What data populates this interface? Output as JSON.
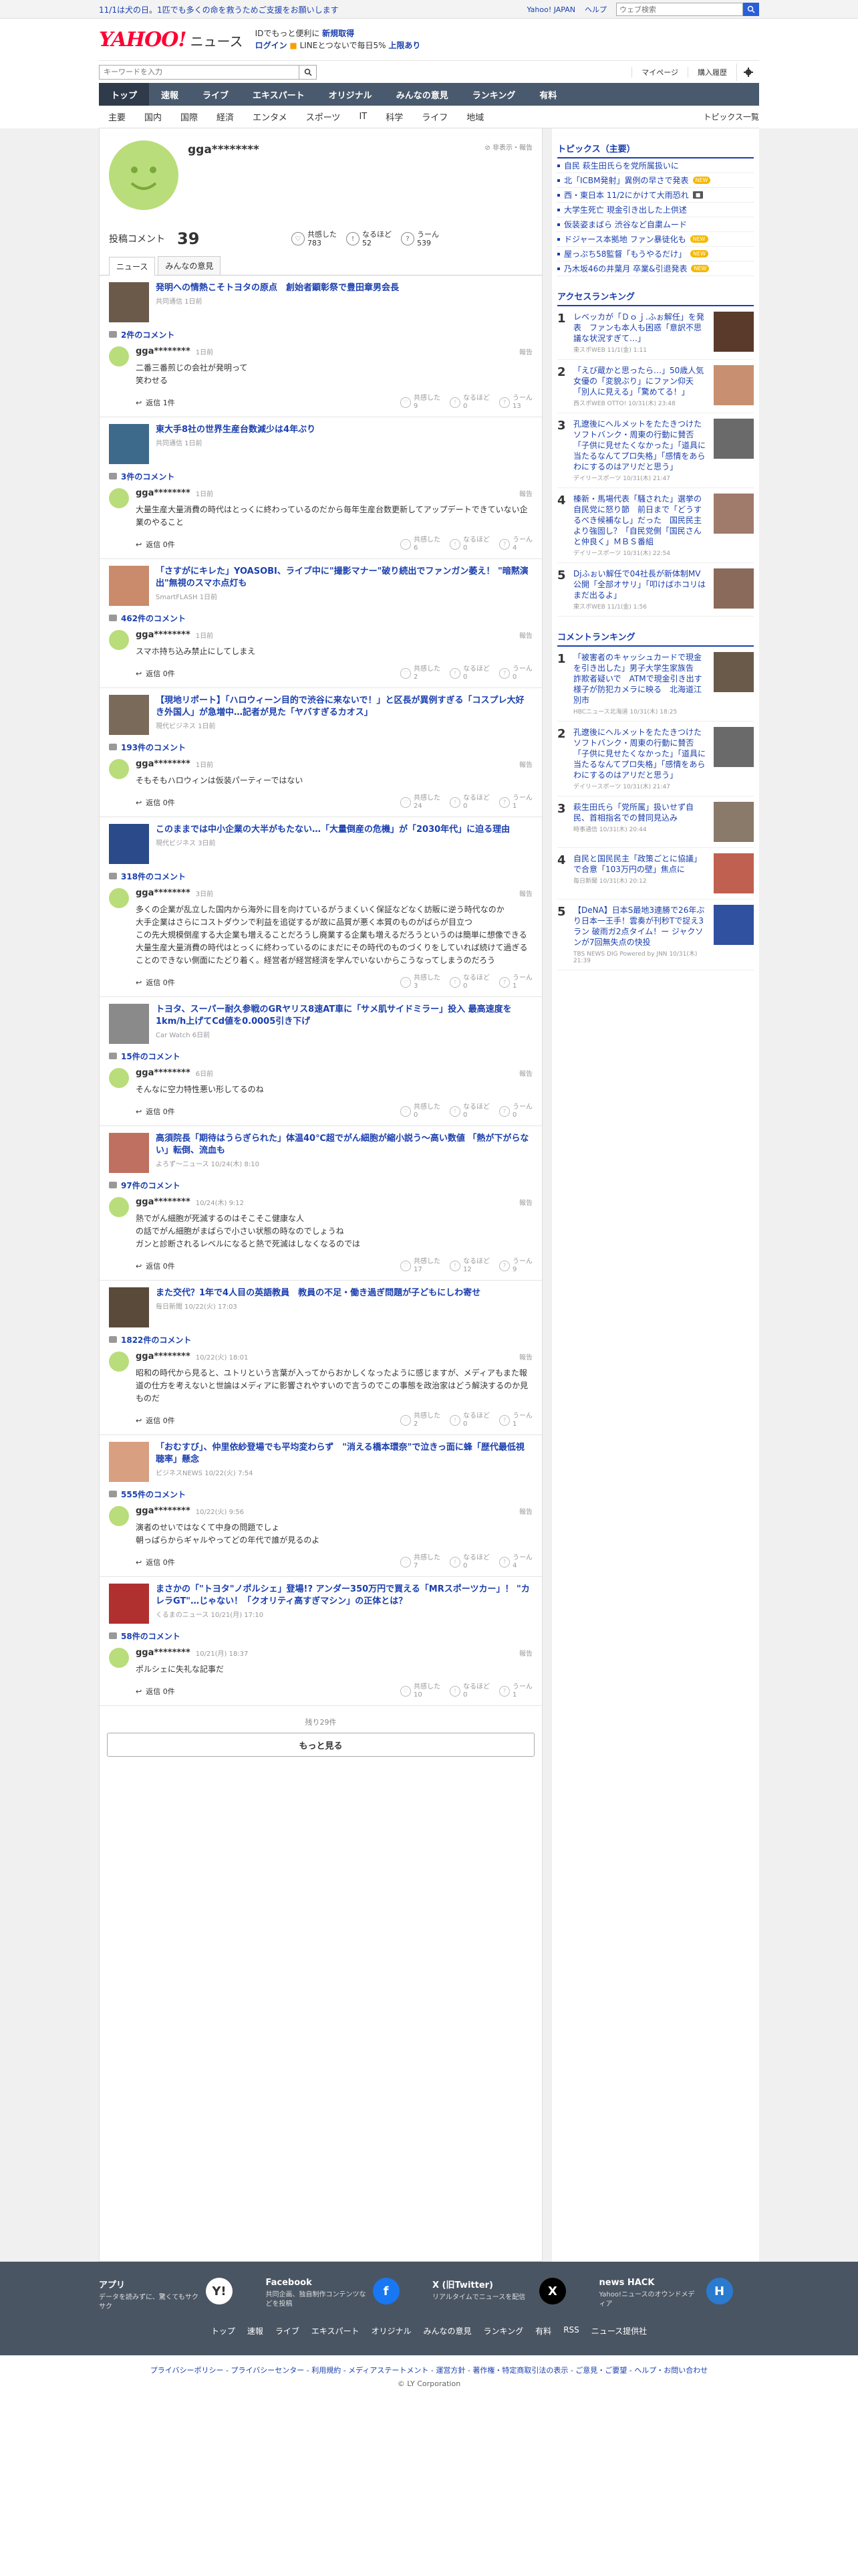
{
  "notice": {
    "text": "11/1は犬の日。1匹でも多くの命を救うためご支援をお願いします",
    "links": [
      "Yahoo! JAPAN",
      "ヘルプ"
    ],
    "search_placeholder": "ウェブ検索"
  },
  "header": {
    "logo": "YAHOO!",
    "logo_sub": "JAPAN",
    "logo_news": "ニュース",
    "promo_line1_a": "IDでもっと便利に",
    "promo_line1_b": "新規取得",
    "promo_line2_a": "ログイン",
    "promo_line2_b": "LINEとつないで毎日5% ",
    "promo_line2_c": "上限あり"
  },
  "searchrow": {
    "placeholder": "キーワードを入力",
    "links": [
      "マイページ",
      "購入履歴"
    ]
  },
  "gnav": [
    "トップ",
    "速報",
    "ライブ",
    "エキスパート",
    "オリジナル",
    "みんなの意見",
    "ランキング",
    "有料"
  ],
  "subnav": [
    "主要",
    "国内",
    "国際",
    "経済",
    "エンタメ",
    "スポーツ",
    "IT",
    "科学",
    "ライフ",
    "地域"
  ],
  "subnav_right": "トピックス一覧",
  "profile": {
    "name": "gga********",
    "flags": "非表示・報告",
    "stats_label": "投稿コメント",
    "stats_count": "39",
    "reactions": [
      {
        "label": "共感した",
        "value": "783"
      },
      {
        "label": "なるほど",
        "value": "52"
      },
      {
        "label": "うーん",
        "value": "539"
      }
    ],
    "tabs": [
      "ニュース",
      "みんなの意見"
    ]
  },
  "blocks": [
    {
      "title": "発明への情熱こそトヨタの原点　創始者顕彰祭で豊田章男会長",
      "src": "共同通信 1日前",
      "count": "2件のコメント",
      "name": "gga********",
      "date": "1日前",
      "text": "二番三番煎じの会社が発明って\n笑わせる",
      "reply": "返信 1件",
      "rx": [
        "9",
        "0",
        "13"
      ]
    },
    {
      "title": "東大手8社の世界生産台数減少は4年ぶり",
      "src": "共同通信 1日前",
      "count": "3件のコメント",
      "name": "gga********",
      "date": "1日前",
      "text": "大量生産大量消費の時代はとっくに終わっているのだから毎年生産台数更新してアップデートできていない企業のやること",
      "reply": "返信 0件",
      "rx": [
        "6",
        "0",
        "4"
      ]
    },
    {
      "title": "「さすがにキレた」YOASOBI、ライブ中に\"撮影マナー\"破り続出でファンガン萎え！ \"暗黙演出\"無視のスマホ点灯も",
      "src": "SmartFLASH 1日前",
      "count": "462件のコメント",
      "name": "gga********",
      "date": "1日前",
      "text": "スマホ持ち込み禁止にしてしまえ",
      "reply": "返信 0件",
      "rx": [
        "2",
        "0",
        "0"
      ]
    },
    {
      "title": "【現地リポート】「ハロウィーン目的で渋谷に来ないで！」と区長が異例すぎる「コスプレ大好き外国人」が急増中…記者が見た「ヤバすぎるカオス」",
      "src": "現代ビジネス 1日前",
      "count": "193件のコメント",
      "name": "gga********",
      "date": "1日前",
      "text": "そもそもハロウィンは仮装パーティーではない",
      "reply": "返信 0件",
      "rx": [
        "24",
        "0",
        "1"
      ]
    },
    {
      "title": "このままでは中小企業の大半がもたない…「大量倒産の危機」が「2030年代」に迫る理由",
      "src": "現代ビジネス 3日前",
      "count": "318件のコメント",
      "name": "gga********",
      "date": "3日前",
      "text": "多くの企業が乱立した国内から海外に目を向けているがうまくいく保証などなく訪販に逆う時代なのか\n大手企業はさらにコストダウンで利益を追従するが故に品質が悪く本質のものがばらが目立つ\nこの先大規模倒産する大企業も増えることだろうし廃業する企業も増えるだろうというのは簡単に想像できる\n大量生産大量消費の時代はとっくに終わっているのにまだにその時代のものづくりをしていれば続けて過ぎることのできない側面にたどり着く。経営者が経営経済を学んでいないからこうなってしまうのだろう",
      "reply": "返信 0件",
      "rx": [
        "3",
        "0",
        "1"
      ]
    },
    {
      "title": "トヨタ、スーパー耐久参戦のGRヤリス8速AT車に「サメ肌サイドミラー」投入 最高速度を1km/h上げてCd値を0.0005引き下げ",
      "src": "Car Watch 6日前",
      "count": "15件のコメント",
      "name": "gga********",
      "date": "6日前",
      "text": "そんなに空力特性悪い形してるのね",
      "reply": "返信 0件",
      "rx": [
        "0",
        "0",
        "0"
      ]
    },
    {
      "title": "高須院長「期待はうらぎられた」体温40℃超でがん細胞が縮小説う〜高い数値 「熱が下がらない」転倒、流血も",
      "src": "よろず〜ニュース 10/24(木) 8:10",
      "count": "97件のコメント",
      "name": "gga********",
      "date": "10/24(木) 9:12",
      "text": "熱でがん細胞が死滅するのはそこそこ健康な人\nの話でがん細胞がまばらで小さい状態の時なのでしょうね\nガンと診断されるレベルになると熱で死滅はしなくなるのでは",
      "reply": "返信 0件",
      "rx": [
        "17",
        "12",
        "9"
      ]
    },
    {
      "title": "また交代？1年で4人目の英語教員　教員の不足・働き過ぎ問題が子どもにしわ寄せ",
      "src": "毎日新聞 10/22(火) 17:03",
      "count": "1822件のコメント",
      "name": "gga********",
      "date": "10/22(火) 18:01",
      "text": "昭和の時代から見ると、ユトリという言葉が入ってからおかしくなったように感じますが、メディアもまた報道の仕方を考えないと世論はメディアに影響されやすいので言うのでこの事態を政治家はどう解決するのか見ものだ",
      "reply": "返信 0件",
      "rx": [
        "2",
        "0",
        "1"
      ]
    },
    {
      "title": "「おむすび」、仲里依紗登場でも平均変わらず　\"消える橋本環奈\"で泣きっ面に蜂「歴代最低視聴率」懸念",
      "src": "ビジネスNEWS 10/22(火) 7:54",
      "count": "555件のコメント",
      "name": "gga********",
      "date": "10/22(火) 9:56",
      "text": "演者のせいではなくて中身の問題でしょ\n朝っぱらからギャルやってどの年代で誰が見るのよ",
      "reply": "返信 0件",
      "rx": [
        "7",
        "0",
        "4"
      ]
    },
    {
      "title": "まさかの「\"トヨタ\"ノポルシェ」登場!? アンダー350万円で買える「MRスポーツカー」！ \"カレラGT\"…じゃない！「クオリティ高すぎマシン」の正体とは？",
      "src": "くるまのニュース 10/21(月) 17:10",
      "count": "58件のコメント",
      "name": "gga********",
      "date": "10/21(月) 18:37",
      "text": "ポルシェに失礼な記事だ",
      "reply": "返信 0件",
      "rx": [
        "10",
        "0",
        "1"
      ]
    }
  ],
  "rx_labels": [
    "共感した",
    "なるほど",
    "うーん"
  ],
  "report_label": "報告",
  "remain": "残り29件",
  "more": "もっと見る",
  "side": {
    "topics_title": "トピックス（主要）",
    "topics": [
      {
        "t": "自民 萩生田氏らを党所属扱いに",
        "b": ""
      },
      {
        "t": "北「ICBM発射」異例の早さで発表",
        "b": "NEW"
      },
      {
        "t": "西・東日本 11/2にかけて大雨恐れ",
        "b": "g"
      },
      {
        "t": "大学生死亡 現金引き出した上供述",
        "b": ""
      },
      {
        "t": "仮装姿まばら 渋谷など自粛ムード",
        "b": ""
      },
      {
        "t": "ドジャース本拠地 ファン暴徒化も",
        "b": "NEW"
      },
      {
        "t": "屋っぷち58監督「もうやるだけ」",
        "b": "NEW"
      },
      {
        "t": "乃木坂46の井葉月 卒業&引退発表",
        "b": "NEW"
      }
    ],
    "access_title": "アクセスランキング",
    "access": [
      {
        "n": "1",
        "t": "レベッカが「Ｄｏｊ.ふぉ解任」を発表　ファンも本人も困惑「意訳不思議な状況すぎて…」",
        "s": "東スポWEB 11/1(金) 1:11"
      },
      {
        "n": "2",
        "t": "「えび蔵かと思ったら…」50歳人気女優の「変貌ぶり」にファン仰天「別人に見える」「驚めてる！」",
        "s": "西スポWEB OTTO! 10/31(木) 23:48"
      },
      {
        "n": "3",
        "t": "孔遼後にヘルメットをたたきつけたソフトバンク・周東の行動に賛否「子供に見せたくなかった」「道具に当たるなんてプロ失格」「感情をあらわにするのはアリだと思う」",
        "s": "デイリースポーツ 10/31(木) 21:47"
      },
      {
        "n": "4",
        "t": "榛新・馬場代表「騒された」選挙の自民党に怒り節　前日まで「どうするべき候補なし」だった　国民民主より強固し？「自民党側「国民さんと仲良く」ＭＢＳ番組",
        "s": "デイリースポーツ 10/31(木) 22:54"
      },
      {
        "n": "5",
        "t": "Djふぉい解任で04社長が新体制MV公開「全部オサリ」「叩けばホコリはまだ出るよ」",
        "s": "東スポWEB 11/1(金) 1:56"
      }
    ],
    "comment_title": "コメントランキング",
    "comment": [
      {
        "n": "1",
        "t": "「被害者のキャッシュカードで現金を引き出した」男子大学生家族告　詐欺者疑いで　ATMで現金引き出す様子が防犯カメラに映る　北海道江別市",
        "s": "HBCニュース北海道 10/31(木) 18:25"
      },
      {
        "n": "2",
        "t": "孔遼後にヘルメットをたたきつけたソフトバンク・周東の行動に賛否「子供に見せたくなかった」「道具に当たるなんてプロ失格」「感情をあらわにするのはアリだと思う」",
        "s": "デイリースポーツ 10/31(木) 21:47"
      },
      {
        "n": "3",
        "t": "萩生田氏ら「党所属」扱いせず自民、首相指名での賛同見込み",
        "s": "時事通信 10/31(木) 20:44"
      },
      {
        "n": "4",
        "t": "自民と国民民主「政策ごとに協議」で合意「103万円の壁」焦点に",
        "s": "毎日新聞 10/31(木) 20:12"
      },
      {
        "n": "5",
        "t": "【DeNA】日本S最地3連勝で26年ぶり日本一王手！雲奏が刊秒Tで捉え3ラン 破雨ガ2点タイム！ー ジャクソンが7回無失点の快投",
        "s": "TBS NEWS DIG Powered by JNN 10/31(木) 21:39"
      }
    ]
  },
  "footer": {
    "items": [
      {
        "t": "アプリ",
        "d": "データを読みずに、驚くてもサクサク",
        "icon": "Y!"
      },
      {
        "t": "Facebook",
        "d": "共同企画、独自制作コンテンツなどを投稿",
        "icon": "f"
      },
      {
        "t": "X (旧Twitter)",
        "d": "リアルタイムでニュースを配信",
        "icon": "X"
      },
      {
        "t": "news HACK",
        "d": "Yahoo!ニュースのオウンドメディア",
        "icon": "H"
      }
    ],
    "links": [
      "トップ",
      "速報",
      "ライブ",
      "エキスパート",
      "オリジナル",
      "みんなの意見",
      "ランキング",
      "有料",
      "RSS",
      "ニュース提供社"
    ],
    "legal": "プライバシーポリシー - プライバシーセンター - 利用規約 - メディアステートメント - 運営方針 - 著作権・特定商取引法の表示 - ご意見・ご要望 - ヘルプ・お問い合わせ",
    "copy": "© LY Corporation"
  }
}
